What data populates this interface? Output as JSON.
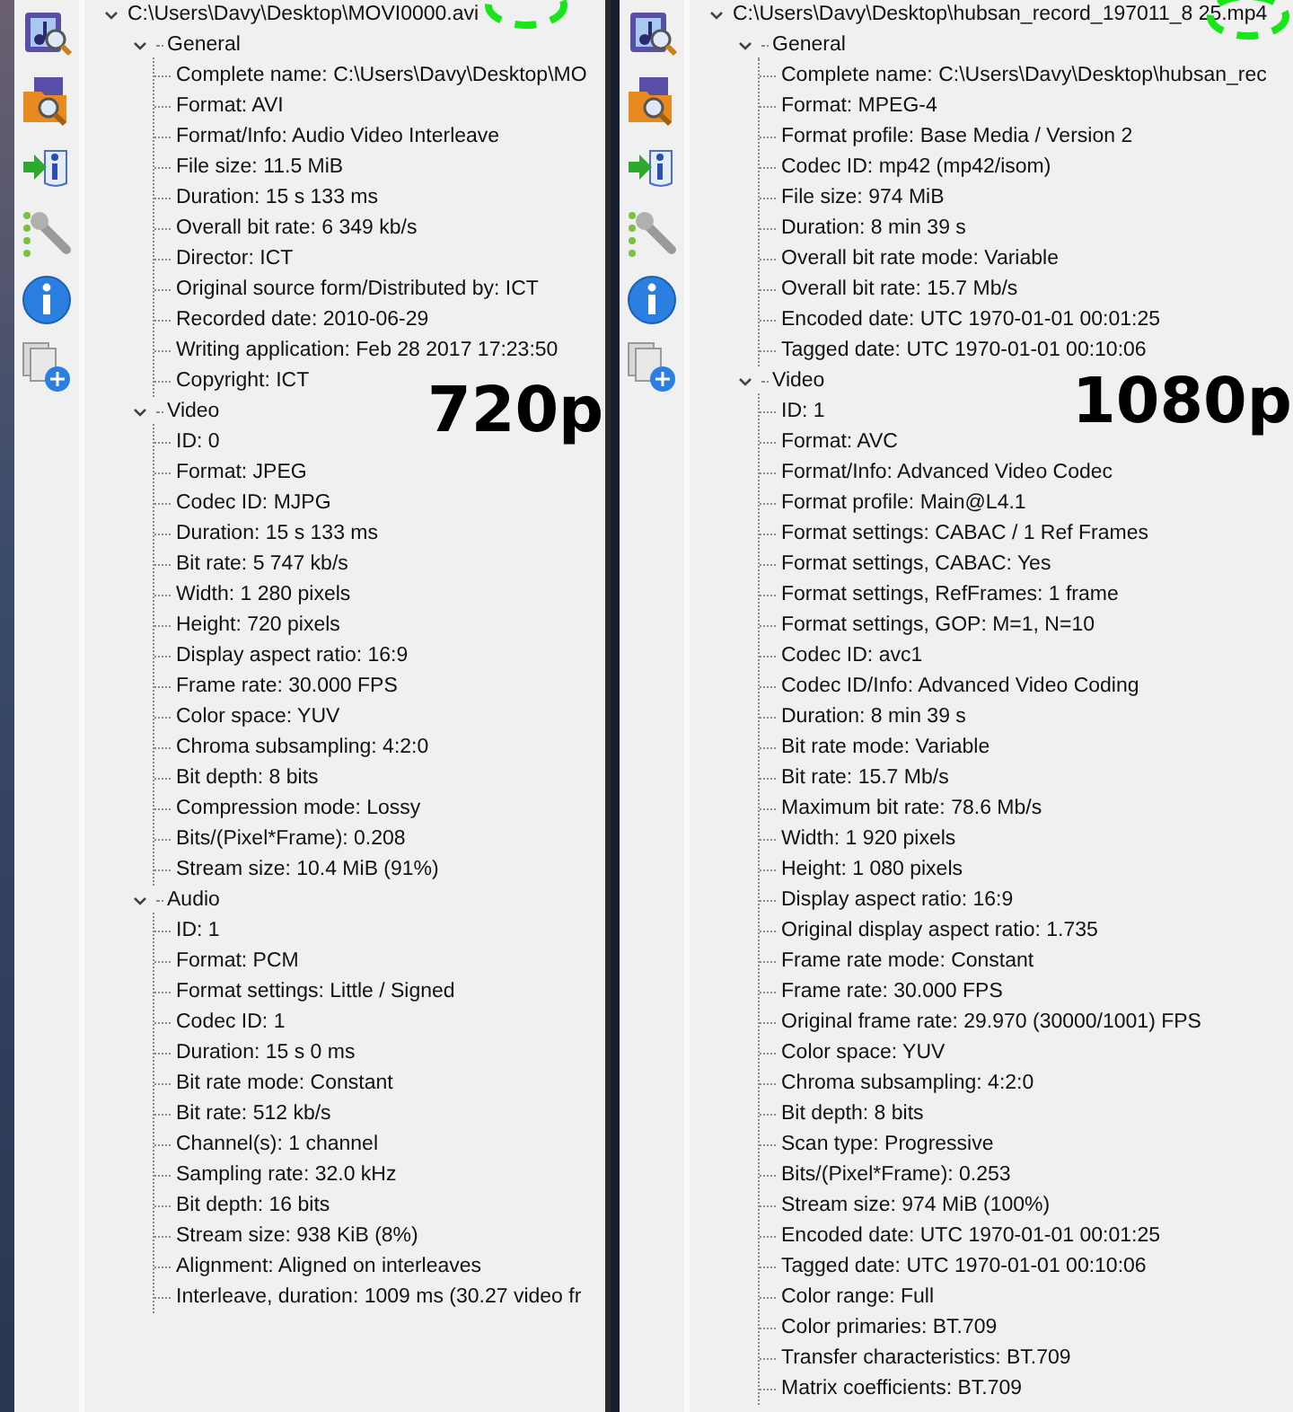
{
  "panels": [
    {
      "root": {
        "label": "C:\\Users\\Davy\\Desktop\\MOVI0000.avi",
        "expanded": true
      },
      "overlay_label": "720p",
      "sections": [
        {
          "title": "General",
          "expanded": true,
          "items": [
            "Complete name: C:\\Users\\Davy\\Desktop\\MO",
            "Format: AVI",
            "Format/Info: Audio Video Interleave",
            "File size: 11.5 MiB",
            "Duration: 15 s 133 ms",
            "Overall bit rate: 6 349 kb/s",
            "Director: ICT",
            "Original source form/Distributed by: ICT",
            "Recorded date: 2010-06-29",
            "Writing application: Feb 28 2017 17:23:50",
            "Copyright: ICT"
          ]
        },
        {
          "title": "Video",
          "expanded": true,
          "items": [
            "ID: 0",
            "Format: JPEG",
            "Codec ID: MJPG",
            "Duration: 15 s 133 ms",
            "Bit rate: 5 747 kb/s",
            "Width: 1 280 pixels",
            "Height: 720 pixels",
            "Display aspect ratio: 16:9",
            "Frame rate: 30.000 FPS",
            "Color space: YUV",
            "Chroma subsampling: 4:2:0",
            "Bit depth: 8 bits",
            "Compression mode: Lossy",
            "Bits/(Pixel*Frame): 0.208",
            "Stream size: 10.4 MiB (91%)"
          ]
        },
        {
          "title": "Audio",
          "expanded": true,
          "items": [
            "ID: 1",
            "Format: PCM",
            "Format settings: Little / Signed",
            "Codec ID: 1",
            "Duration: 15 s 0 ms",
            "Bit rate mode: Constant",
            "Bit rate: 512 kb/s",
            "Channel(s): 1 channel",
            "Sampling rate: 32.0 kHz",
            "Bit depth: 16 bits",
            "Stream size: 938 KiB (8%)",
            "Alignment: Aligned on interleaves",
            "Interleave, duration: 1009  ms (30.27 video fr"
          ]
        }
      ]
    },
    {
      "root": {
        "label": "C:\\Users\\Davy\\Desktop\\hubsan_record_197011_8 25.mp4",
        "expanded": true
      },
      "overlay_label": "1080p",
      "sections": [
        {
          "title": "General",
          "expanded": true,
          "items": [
            "Complete name: C:\\Users\\Davy\\Desktop\\hubsan_rec",
            "Format: MPEG-4",
            "Format profile: Base Media / Version 2",
            "Codec ID: mp42 (mp42/isom)",
            "File size: 974 MiB",
            "Duration: 8 min 39 s",
            "Overall bit rate mode: Variable",
            "Overall bit rate: 15.7 Mb/s",
            "Encoded date: UTC 1970-01-01 00:01:25",
            "Tagged date: UTC 1970-01-01 00:10:06"
          ]
        },
        {
          "title": "Video",
          "expanded": true,
          "items": [
            "ID: 1",
            "Format: AVC",
            "Format/Info: Advanced Video Codec",
            "Format profile: Main@L4.1",
            "Format settings: CABAC / 1 Ref Frames",
            "Format settings, CABAC: Yes",
            "Format settings, RefFrames: 1 frame",
            "Format settings, GOP: M=1, N=10",
            "Codec ID: avc1",
            "Codec ID/Info: Advanced Video Coding",
            "Duration: 8 min 39 s",
            "Bit rate mode: Variable",
            "Bit rate: 15.7 Mb/s",
            "Maximum bit rate: 78.6 Mb/s",
            "Width: 1 920 pixels",
            "Height: 1 080 pixels",
            "Display aspect ratio: 16:9",
            "Original display aspect ratio: 1.735",
            "Frame rate mode: Constant",
            "Frame rate: 30.000 FPS",
            "Original frame rate: 29.970 (30000/1001) FPS",
            "Color space: YUV",
            "Chroma subsampling: 4:2:0",
            "Bit depth: 8 bits",
            "Scan type: Progressive",
            "Bits/(Pixel*Frame): 0.253",
            "Stream size: 974 MiB (100%)",
            "Encoded date: UTC 1970-01-01 00:01:25",
            "Tagged date: UTC 1970-01-01 00:10:06",
            "Color range: Full",
            "Color primaries: BT.709",
            "Transfer characteristics: BT.709",
            "Matrix coefficients: BT.709"
          ]
        }
      ]
    }
  ]
}
